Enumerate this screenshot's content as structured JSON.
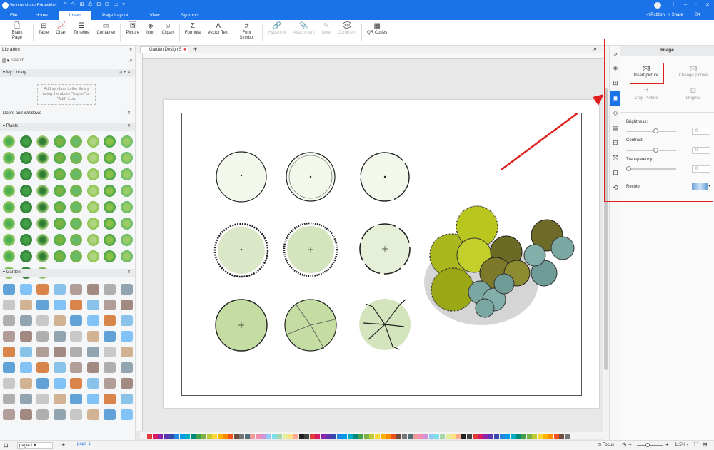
{
  "app": {
    "title": "Wondershare EdrawMax"
  },
  "menu": [
    {
      "label": "File",
      "active": false
    },
    {
      "label": "Home",
      "active": false
    },
    {
      "label": "Insert",
      "active": true
    },
    {
      "label": "Page Layout",
      "active": false
    },
    {
      "label": "View",
      "active": false
    },
    {
      "label": "Symbols",
      "active": false
    }
  ],
  "top_right": {
    "publish": "Publish",
    "share": "Share"
  },
  "ribbon": [
    {
      "label": "Blank Page",
      "icon": "blank-page-icon",
      "glyph": "🗋",
      "enabled": true
    },
    {
      "label": "Table",
      "icon": "table-icon",
      "glyph": "⊞",
      "enabled": true
    },
    {
      "label": "Chart",
      "icon": "chart-icon",
      "glyph": "📈",
      "enabled": true
    },
    {
      "label": "Timeline",
      "icon": "timeline-icon",
      "glyph": "☰",
      "enabled": true
    },
    {
      "label": "Container",
      "icon": "container-icon",
      "glyph": "▭",
      "enabled": true
    },
    {
      "label": "Picture",
      "icon": "picture-icon",
      "glyph": "🖼",
      "enabled": true
    },
    {
      "label": "Icon",
      "icon": "icon-insert-icon",
      "glyph": "◈",
      "enabled": true
    },
    {
      "label": "Clipart",
      "icon": "clipart-icon",
      "glyph": "☺",
      "enabled": true
    },
    {
      "label": "Formula",
      "icon": "formula-icon",
      "glyph": "Σ",
      "enabled": true
    },
    {
      "label": "Vector Text",
      "icon": "vector-text-icon",
      "glyph": "A",
      "enabled": true
    },
    {
      "label": "Font Symbol",
      "icon": "font-symbol-icon",
      "glyph": "#",
      "enabled": true
    },
    {
      "label": "Hyperlink",
      "icon": "hyperlink-icon",
      "glyph": "🔗",
      "enabled": false
    },
    {
      "label": "Attachment",
      "icon": "attachment-icon",
      "glyph": "📎",
      "enabled": false
    },
    {
      "label": "Note",
      "icon": "note-icon",
      "glyph": "✎",
      "enabled": false
    },
    {
      "label": "Comment",
      "icon": "comment-icon",
      "glyph": "💬",
      "enabled": false
    },
    {
      "label": "QR Codes",
      "icon": "qr-code-icon",
      "glyph": "▦",
      "enabled": true
    }
  ],
  "libraries": {
    "title": "Libraries",
    "search_placeholder": "search",
    "my_library": "My Library",
    "my_library_hint": "Add symbols to the library using the above \"Import\" or \"Add\" icon.",
    "sections": {
      "doors": "Doors and Windows",
      "plants": "Plants",
      "garden": "Garden"
    }
  },
  "doc": {
    "tab": "Garden Design 5"
  },
  "panel": {
    "title": "Image",
    "insert_picture": "Insert picture",
    "change_picture": "Change picture",
    "crop_picture": "Crop Picture",
    "original": "Original",
    "brightness": "Brightness:",
    "contrast": "Contrast:",
    "transparency": "Transparency:",
    "recolor": "Recolor",
    "brightness_value": "0",
    "contrast_value": "0",
    "transparency_value": "0"
  },
  "status": {
    "page_select": "page-1",
    "page_tab": "page-1",
    "focus": "Focus",
    "zoom": "115%"
  },
  "colors": {
    "accent": "#1a73e8",
    "highlight": "#e02020"
  }
}
